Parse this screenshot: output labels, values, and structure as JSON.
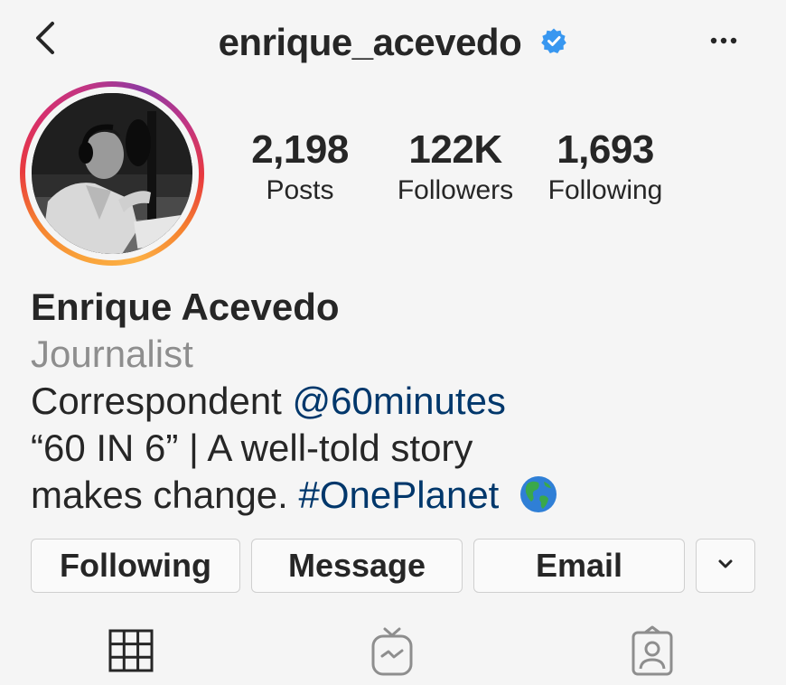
{
  "header": {
    "username": "enrique_acevedo",
    "verified": true,
    "back_icon": "chevron-left-icon",
    "more_icon": "more-horizontal-icon"
  },
  "stats": {
    "posts": {
      "value": "2,198",
      "label": "Posts"
    },
    "followers": {
      "value": "122K",
      "label": "Followers"
    },
    "following": {
      "value": "1,693",
      "label": "Following"
    }
  },
  "profile": {
    "name": "Enrique Acevedo",
    "category": "Journalist",
    "bio": {
      "line1_text": "Correspondent ",
      "line1_mention": "@60minutes",
      "line2_text": "“60 IN 6” | A well-told story",
      "line3_text": "makes change. ",
      "line3_hashtag": "#OnePlanet",
      "line3_emoji": "globe-americas-icon"
    }
  },
  "actions": {
    "following_label": "Following",
    "message_label": "Message",
    "email_label": "Email",
    "more_icon": "chevron-down-icon"
  },
  "tabs": {
    "items": [
      "grid-icon",
      "igtv-icon",
      "tagged-icon"
    ]
  },
  "colors": {
    "link": "#00376b",
    "verified": "#3897f0",
    "secondary_text": "#8e8e8e",
    "background": "#f5f5f5"
  }
}
